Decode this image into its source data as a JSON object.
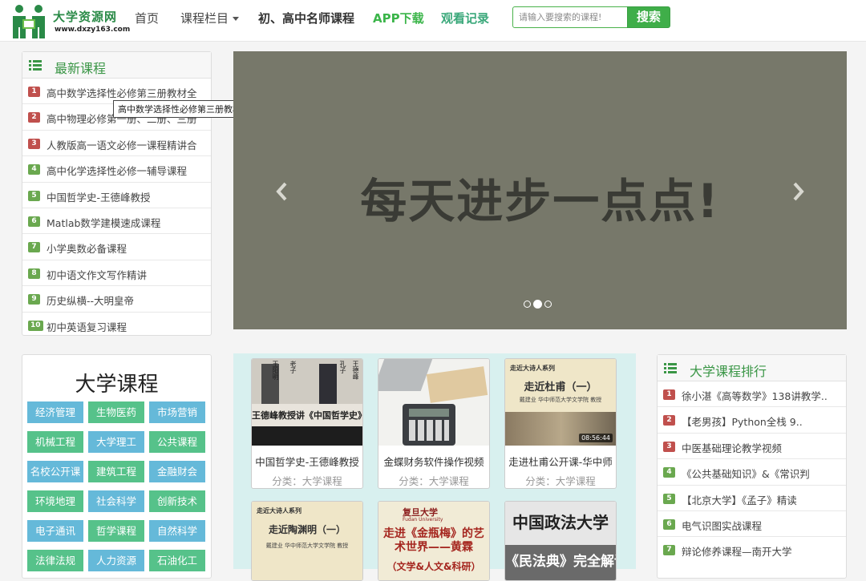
{
  "site": {
    "name": "大学资源网",
    "url": "www.dxzy163.com"
  },
  "nav": {
    "home": "首页",
    "categories": "课程栏目",
    "famous_teachers": "初、高中名师课程",
    "app_download": "APP下载",
    "watch_history": "观看记录"
  },
  "search": {
    "placeholder": "请输入要搜索的课程!",
    "button": "搜索"
  },
  "latest": {
    "title": "最新课程",
    "items": [
      {
        "num": "1",
        "label": "高中数学选择性必修第三册教材全"
      },
      {
        "num": "2",
        "label": "高中物理必修第一册、二册、三册"
      },
      {
        "num": "3",
        "label": "人教版高一语文必修一课程精讲合"
      },
      {
        "num": "4",
        "label": "高中化学选择性必修一辅导课程"
      },
      {
        "num": "5",
        "label": "中国哲学史-王德峰教授"
      },
      {
        "num": "6",
        "label": "Matlab数学建模速成课程"
      },
      {
        "num": "7",
        "label": "小学奥数必备课程"
      },
      {
        "num": "8",
        "label": "初中语文作文写作精讲"
      },
      {
        "num": "9",
        "label": "历史纵横--大明皇帝"
      },
      {
        "num": "10",
        "label": "初中英语复习课程"
      }
    ],
    "tooltip": "高中数学选择性必修第三册教材全解"
  },
  "carousel": {
    "slogan": "每天进步一点点!",
    "slide_count": 3,
    "active_slide": 2
  },
  "university": {
    "title": "大学课程",
    "tags": [
      "经济管理",
      "生物医药",
      "市场营销",
      "机械工程",
      "大学理工",
      "公共课程",
      "名校公开课",
      "建筑工程",
      "金融财会",
      "环境地理",
      "社会科学",
      "创新技术",
      "电子通讯",
      "哲学课程",
      "自然科学",
      "法律法规",
      "人力资源",
      "石油化工"
    ]
  },
  "videos": [
    {
      "title": "中国哲学史-王德峰教授",
      "category": "分类：大学课程",
      "thumb_text": "王德峰教授讲《中国哲学史》",
      "thumb_names": [
        "王阳明",
        "老子",
        "孔子",
        "王德峰"
      ]
    },
    {
      "title": "金蝶财务软件操作视频",
      "category": "分类：大学课程"
    },
    {
      "title": "走进杜甫公开课-华中师",
      "category": "分类：大学课程",
      "duration": "08:56:44",
      "thumb_series": "走近大诗人系列",
      "thumb_heading": "走近杜甫（一）",
      "thumb_author": "戴建业 华中师范大学文学院 教授"
    },
    {
      "title": "",
      "category": "",
      "thumb_series": "走近大诗人系列",
      "thumb_heading": "走近陶渊明（一）",
      "thumb_author": "戴建业 华中师范大学文学院 教授"
    },
    {
      "title": "",
      "category": "",
      "thumb_school": "复旦大学",
      "thumb_school_en": "Fudan University",
      "thumb_heading": "走进《金瓶梅》的艺术世界——黄霖",
      "thumb_sub": "（文学&人文&科研）"
    },
    {
      "title": "",
      "category": "",
      "thumb_heading": "中国政法大学",
      "thumb_sub": "《民法典》完全解读"
    }
  ],
  "ranking": {
    "title": "大学课程排行",
    "items": [
      {
        "num": "1",
        "label": "徐小湛《高等数学》138讲教学.."
      },
      {
        "num": "2",
        "label": "【老男孩】Python全栈 9.."
      },
      {
        "num": "3",
        "label": "中医基础理论教学视频"
      },
      {
        "num": "4",
        "label": "《公共基础知识》&《常识判"
      },
      {
        "num": "5",
        "label": "【北京大学】《孟子》精读"
      },
      {
        "num": "6",
        "label": "电气识图实战课程"
      },
      {
        "num": "7",
        "label": "辩论修养课程—南开大学"
      }
    ]
  },
  "colors": {
    "brand_green": "#3fae49",
    "rank_red": "#c0504d",
    "rank_green": "#6aa84f",
    "tag_blue": "#65b9d9",
    "tag_green": "#56c28a"
  }
}
